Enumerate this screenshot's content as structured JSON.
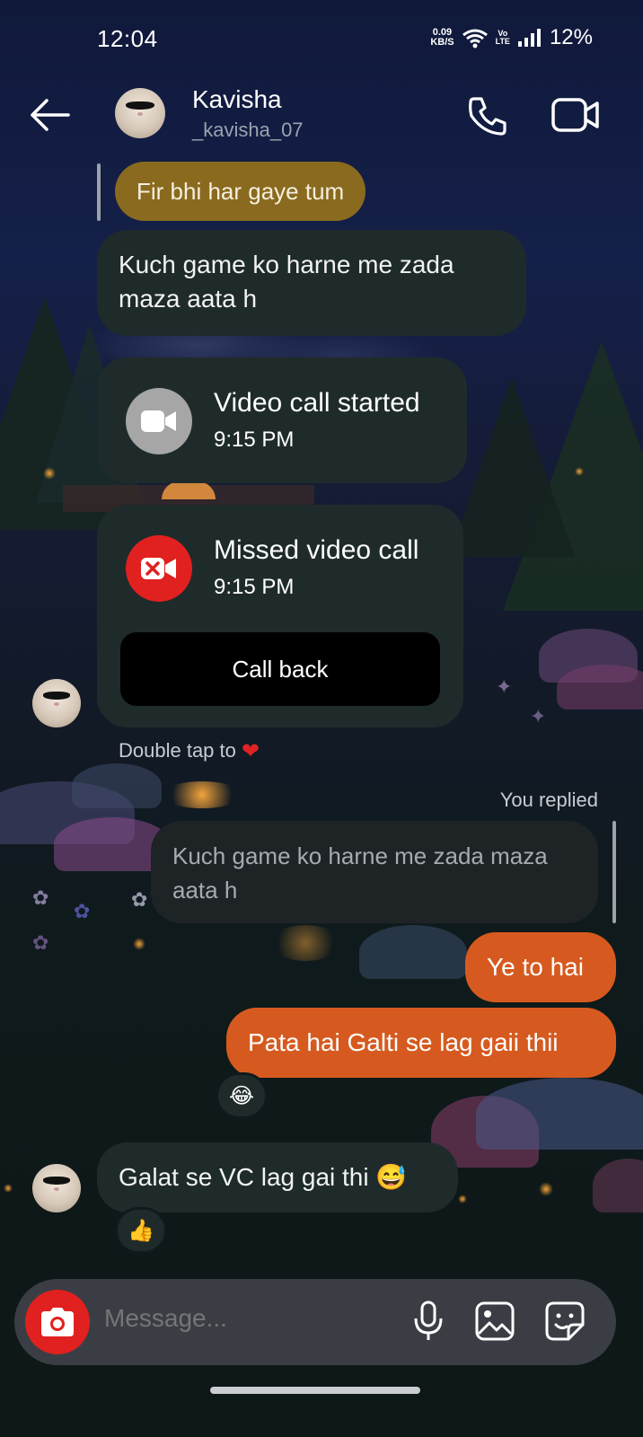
{
  "status_bar": {
    "time": "12:04",
    "net_speed_value": "0.09",
    "net_speed_unit": "KB/S",
    "volte_top": "Vo",
    "volte_bottom": "LTE",
    "battery": "12%"
  },
  "header": {
    "name": "Kavisha",
    "handle": "_kavisha_07"
  },
  "messages": {
    "reply_quote": "Fir bhi har gaye tum",
    "received_1": "Kuch game ko harne me zada maza aata h",
    "video_call": {
      "title": "Video call started",
      "time": "9:15 PM"
    },
    "missed_call": {
      "title": "Missed video call",
      "time": "9:15 PM",
      "button": "Call back"
    },
    "double_tap_hint": "Double tap to",
    "heart": "❤",
    "you_replied": "You replied",
    "replied_quote": "Kuch game ko harne me zada maza aata h",
    "sent_1": "Ye to hai",
    "sent_2": "Pata hai Galti se lag gaii thii",
    "sent_2_reaction": "😂",
    "received_2": "Galat se VC lag gai thi 😅",
    "received_2_reaction": "👍"
  },
  "composer": {
    "placeholder": "Message..."
  },
  "colors": {
    "sent_bubble": "#d65a1f",
    "received_bubble": "#1f2b2b",
    "reply_quote_bubble": "#8a6a1e",
    "missed_call_icon": "#e0211f",
    "camera_button": "#e0211f"
  }
}
